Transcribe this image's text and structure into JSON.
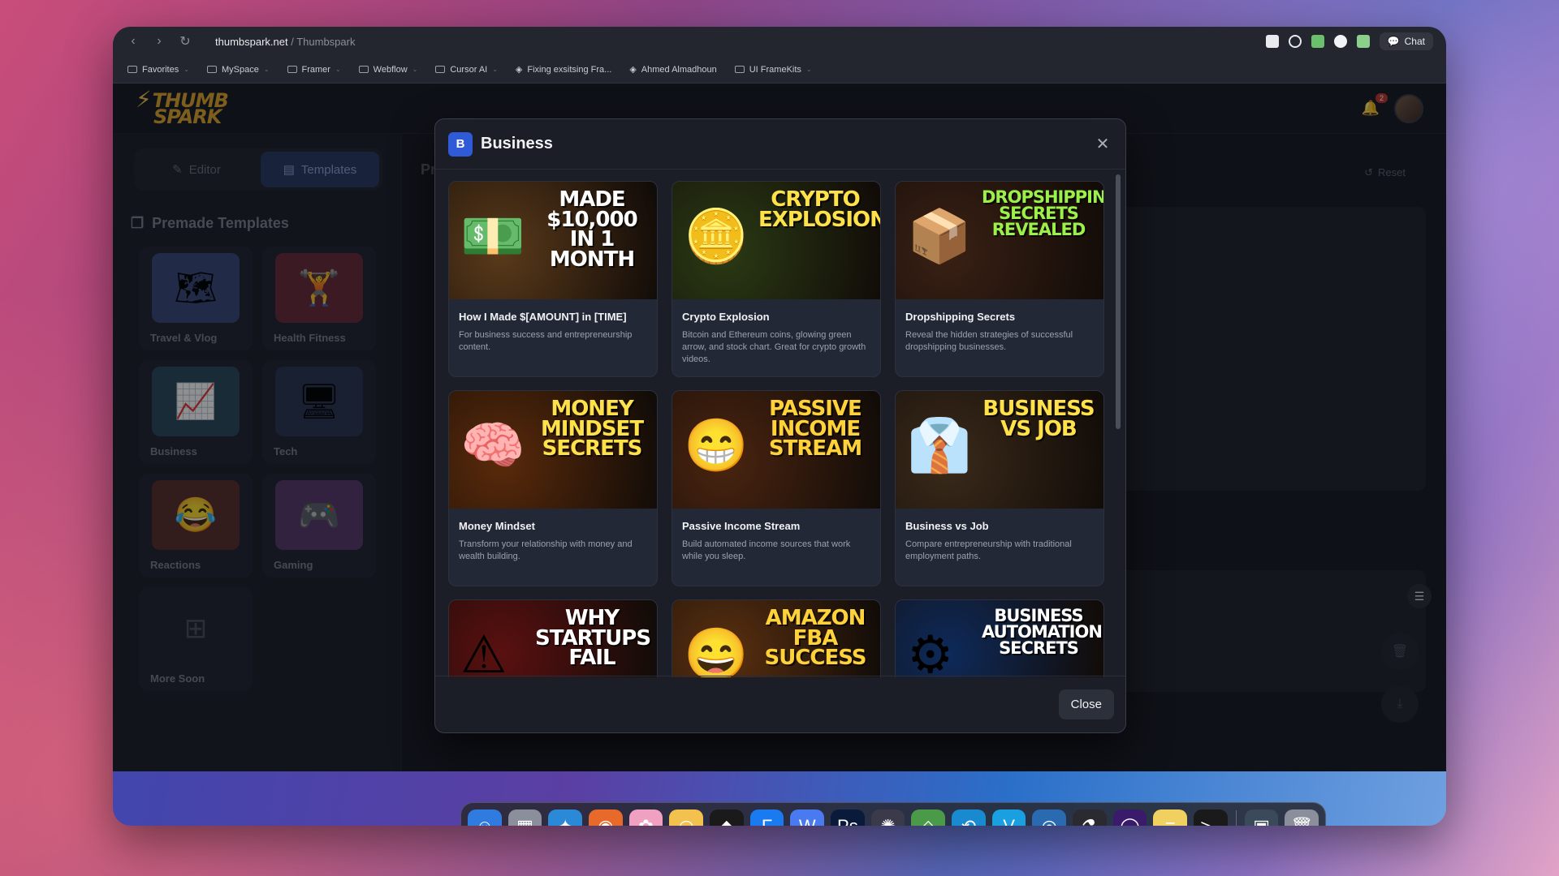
{
  "browser": {
    "url_domain": "thumbspark.net",
    "url_path": "/ Thumbspark",
    "chat_label": "Chat",
    "bookmarks": [
      {
        "label": "Favorites",
        "folder": true
      },
      {
        "label": "MySpace",
        "folder": true
      },
      {
        "label": "Framer",
        "folder": true
      },
      {
        "label": "Webflow",
        "folder": true
      },
      {
        "label": "Cursor AI",
        "folder": true
      },
      {
        "label": "Fixing exsitsing Fra...",
        "folder": false
      },
      {
        "label": "Ahmed Almadhoun",
        "folder": false
      },
      {
        "label": "UI FrameKits",
        "folder": true
      }
    ]
  },
  "app": {
    "logo_top": "THUMB",
    "logo_bottom": "SPARK",
    "notification_count": "2",
    "tabs": {
      "editor": "Editor",
      "templates": "Templates"
    },
    "sidebar_title": "Premade Templates",
    "templates": [
      {
        "label": "Travel & Vlog",
        "icon": "map-search-icon",
        "glyph": "🗺",
        "color": "#3a4a78"
      },
      {
        "label": "Health Fitness",
        "icon": "dumbbell-icon",
        "glyph": "🏋",
        "color": "#6a2b3a"
      },
      {
        "label": "Business",
        "icon": "chart-up-icon",
        "glyph": "📈",
        "color": "#2a4a5a"
      },
      {
        "label": "Tech",
        "icon": "chip-icon",
        "glyph": "🖥",
        "color": "#2a3550"
      },
      {
        "label": "Reactions",
        "icon": "laugh-emoji-icon",
        "glyph": "😂",
        "color": "#5a2f2a"
      },
      {
        "label": "Gaming",
        "icon": "gamepad-icon",
        "glyph": "🎮",
        "color": "#5a3a6a"
      },
      {
        "label": "More Soon",
        "icon": "add-grid-icon",
        "glyph": "⊞",
        "color": "#252a35"
      }
    ],
    "main": {
      "partial_title": "Pr",
      "reset_label": "Reset"
    }
  },
  "modal": {
    "badge_letter": "B",
    "title": "Business",
    "close_label": "Close",
    "cards": [
      {
        "title": "How I Made $[AMOUNT] in [TIME]",
        "desc": "For business success and entrepreneurship content.",
        "headline": "MADE $10,000 IN 1 MONTH",
        "pic": "💵",
        "bg": "#5a3a1a",
        "fg": "#ffffff"
      },
      {
        "title": "Crypto Explosion",
        "desc": "Bitcoin and Ethereum coins, glowing green arrow, and stock chart. Great for crypto growth videos.",
        "headline": "CRYPTO EXPLOSION!",
        "pic": "🪙",
        "bg": "#2a3a14",
        "fg": "#ffe14a"
      },
      {
        "title": "Dropshipping Secrets",
        "desc": "Reveal the hidden strategies of successful dropshipping businesses.",
        "headline": "DROPSHIPPING SECRETS REVEALED",
        "pic": "📦",
        "bg": "#3a2014",
        "fg": "#9cf04a"
      },
      {
        "title": "Money Mindset",
        "desc": "Transform your relationship with money and wealth building.",
        "headline": "MONEY MINDSET SECRETS",
        "pic": "🧠",
        "bg": "#5a2a0a",
        "fg": "#ffe14a"
      },
      {
        "title": "Passive Income Stream",
        "desc": "Build automated income sources that work while you sleep.",
        "headline": "PASSIVE INCOME STREAM",
        "pic": "😁",
        "bg": "#4a2410",
        "fg": "#ffd23a"
      },
      {
        "title": "Business vs Job",
        "desc": "Compare entrepreneurship with traditional employment paths.",
        "headline": "BUSINESS VS JOB",
        "pic": "👔",
        "bg": "#3a2a1a",
        "fg": "#ffe14a"
      },
      {
        "title": "",
        "desc": "",
        "headline": "WHY STARTUPS FAIL",
        "pic": "⚠",
        "bg": "#5a1010",
        "fg": "#ffffff"
      },
      {
        "title": "",
        "desc": "",
        "headline": "AMAZON FBA SUCCESS",
        "pic": "😄",
        "bg": "#5a3010",
        "fg": "#ffd23a"
      },
      {
        "title": "",
        "desc": "",
        "headline": "BUSINESS AUTOMATION SECRETS",
        "pic": "⚙",
        "bg": "#0e2a5a",
        "fg": "#ffffff"
      }
    ]
  },
  "dock": {
    "apps": [
      {
        "name": "finder-icon",
        "glyph": "☺",
        "color": "#2f7be0"
      },
      {
        "name": "launchpad-icon",
        "glyph": "▦",
        "color": "#8a8f9b"
      },
      {
        "name": "safari-icon",
        "glyph": "✦",
        "color": "#2a8ad8"
      },
      {
        "name": "firefox-icon",
        "glyph": "◉",
        "color": "#e86a2a"
      },
      {
        "name": "photos-icon",
        "glyph": "✿",
        "color": "#f0a0c0"
      },
      {
        "name": "arc-icon",
        "glyph": "◠",
        "color": "#f2c14e"
      },
      {
        "name": "cube-app-icon",
        "glyph": "◆",
        "color": "#1a1a1a"
      },
      {
        "name": "framer-icon",
        "glyph": "F",
        "color": "#1a7af0"
      },
      {
        "name": "webflow-icon",
        "glyph": "W",
        "color": "#4a7af0"
      },
      {
        "name": "photoshop-icon",
        "glyph": "Ps",
        "color": "#0a1a3a"
      },
      {
        "name": "davinci-icon",
        "glyph": "✺",
        "color": "#3a3a4a"
      },
      {
        "name": "maps-icon",
        "glyph": "◇",
        "color": "#4a9a4a"
      },
      {
        "name": "chatgpt-icon",
        "glyph": "⟲",
        "color": "#1a8ad0"
      },
      {
        "name": "vimeo-icon",
        "glyph": "V",
        "color": "#1aa0e0"
      },
      {
        "name": "preview-icon",
        "glyph": "◎",
        "color": "#2a6ab0"
      },
      {
        "name": "flask-app-icon",
        "glyph": "⚗",
        "color": "#2a2a30"
      },
      {
        "name": "obs-icon",
        "glyph": "◯",
        "color": "#3a1a6a"
      },
      {
        "name": "notes-icon",
        "glyph": "≡",
        "color": "#f0d060"
      },
      {
        "name": "terminal-icon",
        "glyph": ">_",
        "color": "#1a1a1a"
      }
    ],
    "extra": [
      {
        "name": "screenshot-folder-icon",
        "glyph": "▣",
        "color": "#3a4a5a"
      },
      {
        "name": "trash-icon",
        "glyph": "🗑",
        "color": "#8a8f9b"
      }
    ]
  }
}
